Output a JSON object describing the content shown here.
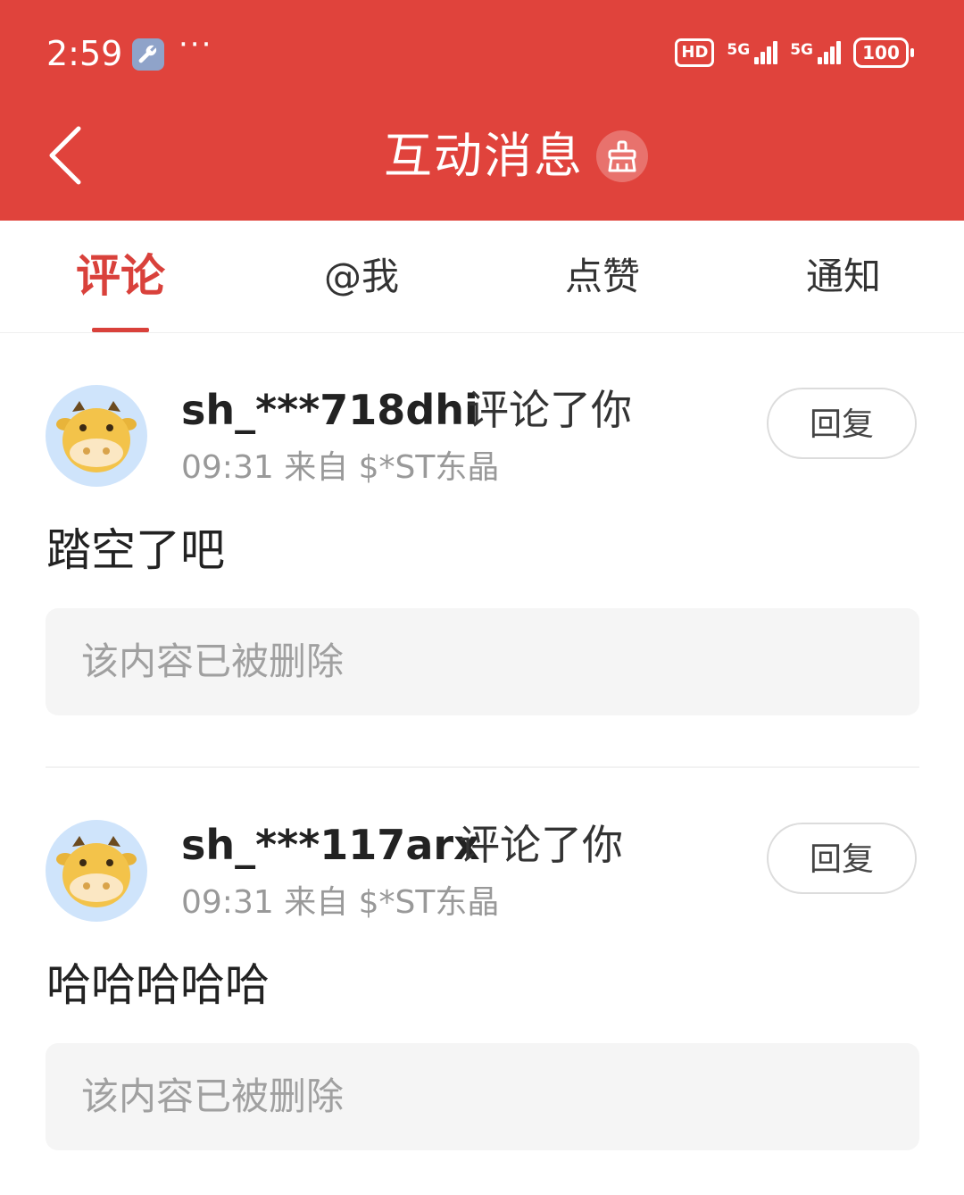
{
  "status_bar": {
    "time": "2:59",
    "dots": "···",
    "hd": "HD",
    "net1_label": "5G",
    "net2_label": "5G",
    "battery": "100"
  },
  "header": {
    "title": "互动消息",
    "back_icon": "chevron-left-icon",
    "clear_icon": "broom-icon",
    "bg_color": "#e0433c"
  },
  "tabs": [
    {
      "label": "评论",
      "active": true
    },
    {
      "label": "@我",
      "active": false
    },
    {
      "label": "点赞",
      "active": false
    },
    {
      "label": "通知",
      "active": false
    }
  ],
  "accent_color": "#d9413b",
  "comments": [
    {
      "username": "sh_***718dhi",
      "action": "评论了你",
      "meta": "09:31 来自 $*ST东晶",
      "reply_label": "回复",
      "text": "踏空了吧",
      "quote": "该内容已被删除"
    },
    {
      "username": "sh_***117arx",
      "action": "评论了你",
      "meta": "09:31 来自 $*ST东晶",
      "reply_label": "回复",
      "text": "哈哈哈哈哈",
      "quote": "该内容已被删除"
    }
  ]
}
